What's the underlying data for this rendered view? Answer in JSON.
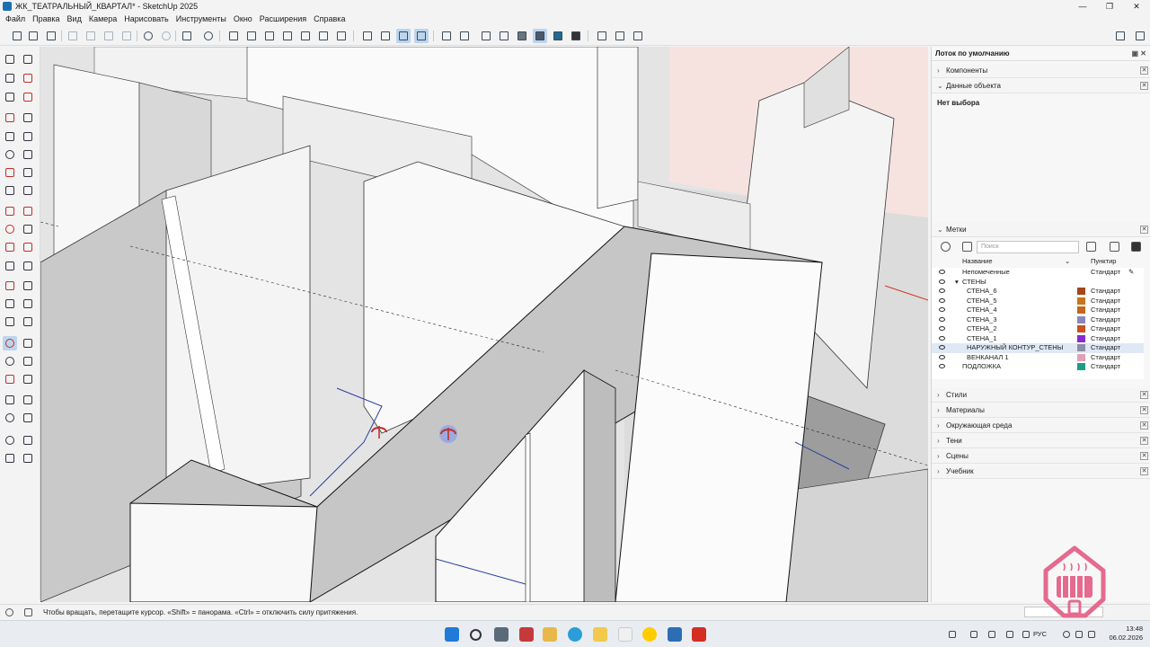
{
  "window": {
    "title": "ЖК_ТЕАТРАЛЬНЫЙ_КВАРТАЛ* - SketchUp 2025"
  },
  "menu": [
    "Файл",
    "Правка",
    "Вид",
    "Камера",
    "Нарисовать",
    "Инструменты",
    "Окно",
    "Расширения",
    "Справка"
  ],
  "tray": {
    "title": "Лоток по умолчанию",
    "panels": {
      "components": "Компоненты",
      "entity_info": "Данные объекта",
      "no_selection": "Нет выбора",
      "tags": "Метки",
      "styles": "Стили",
      "materials": "Материалы",
      "environment": "Окружающая среда",
      "shadows": "Тени",
      "scenes": "Сцены",
      "instructor": "Учебник"
    },
    "tags_search_placeholder": "Поиск",
    "tags_columns": {
      "name": "Название",
      "dash": "Пунктир"
    },
    "tags": [
      {
        "name": "Непомеченные",
        "color": "",
        "dash": "Стандарт",
        "indent": 0,
        "edit": true
      },
      {
        "name": "СТЕНЫ",
        "color": "",
        "dash": "",
        "indent": 0,
        "folder": true
      },
      {
        "name": "СТЕНА_6",
        "color": "#a3461a",
        "dash": "Стандарт",
        "indent": 1
      },
      {
        "name": "СТЕНА_5",
        "color": "#c8741e",
        "dash": "Стандарт",
        "indent": 1
      },
      {
        "name": "СТЕНА_4",
        "color": "#c5651f",
        "dash": "Стандарт",
        "indent": 1
      },
      {
        "name": "СТЕНА_3",
        "color": "#8c86b5",
        "dash": "Стандарт",
        "indent": 1
      },
      {
        "name": "СТЕНА_2",
        "color": "#c9531f",
        "dash": "Стандарт",
        "indent": 1
      },
      {
        "name": "СТЕНА_1",
        "color": "#8a2ad0",
        "dash": "Стандарт",
        "indent": 1
      },
      {
        "name": "НАРУЖНЫЙ КОНТУР_СТЕНЫ",
        "color": "#8a8fa6",
        "dash": "Стандарт",
        "indent": 1,
        "selected": true
      },
      {
        "name": "ВЕНКАНАЛ 1",
        "color": "#e0a0b5",
        "dash": "Стандарт",
        "indent": 1
      },
      {
        "name": "ПОДЛОЖКА",
        "color": "#1a9e8a",
        "dash": "Стандарт",
        "indent": 0
      }
    ]
  },
  "status": {
    "text": "Чтобы вращать, перетащите курсор. «Shift» = панорама. «Ctrl» = отключить силу притяжения."
  },
  "taskbar": {
    "lang": "РУС",
    "time": "13:48",
    "date": "06.02.2026",
    "apps": [
      "windows-start",
      "search",
      "calculator",
      "media",
      "file-explorer",
      "telegram",
      "notes",
      "yandex-browser",
      "sketchup",
      "acrobat"
    ]
  },
  "colors": {
    "selection_blue": "#bcd5ee",
    "axis_red": "#d03a2a"
  }
}
